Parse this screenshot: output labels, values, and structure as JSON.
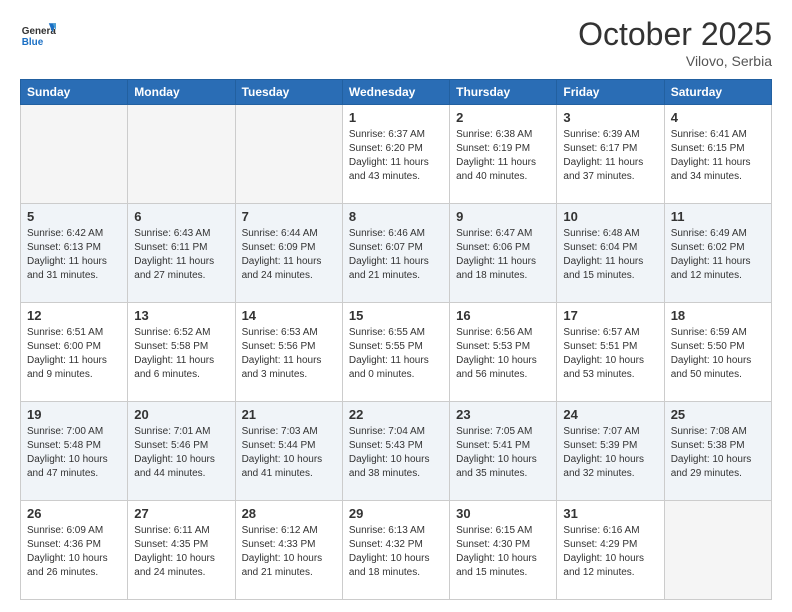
{
  "header": {
    "logo_general": "General",
    "logo_blue": "Blue",
    "month": "October 2025",
    "location": "Vilovo, Serbia"
  },
  "weekdays": [
    "Sunday",
    "Monday",
    "Tuesday",
    "Wednesday",
    "Thursday",
    "Friday",
    "Saturday"
  ],
  "weeks": [
    [
      {
        "day": "",
        "empty": true
      },
      {
        "day": "",
        "empty": true
      },
      {
        "day": "",
        "empty": true
      },
      {
        "day": "1",
        "sunrise": "6:37 AM",
        "sunset": "6:20 PM",
        "daylight": "11 hours and 43 minutes."
      },
      {
        "day": "2",
        "sunrise": "6:38 AM",
        "sunset": "6:19 PM",
        "daylight": "11 hours and 40 minutes."
      },
      {
        "day": "3",
        "sunrise": "6:39 AM",
        "sunset": "6:17 PM",
        "daylight": "11 hours and 37 minutes."
      },
      {
        "day": "4",
        "sunrise": "6:41 AM",
        "sunset": "6:15 PM",
        "daylight": "11 hours and 34 minutes."
      }
    ],
    [
      {
        "day": "5",
        "sunrise": "6:42 AM",
        "sunset": "6:13 PM",
        "daylight": "11 hours and 31 minutes."
      },
      {
        "day": "6",
        "sunrise": "6:43 AM",
        "sunset": "6:11 PM",
        "daylight": "11 hours and 27 minutes."
      },
      {
        "day": "7",
        "sunrise": "6:44 AM",
        "sunset": "6:09 PM",
        "daylight": "11 hours and 24 minutes."
      },
      {
        "day": "8",
        "sunrise": "6:46 AM",
        "sunset": "6:07 PM",
        "daylight": "11 hours and 21 minutes."
      },
      {
        "day": "9",
        "sunrise": "6:47 AM",
        "sunset": "6:06 PM",
        "daylight": "11 hours and 18 minutes."
      },
      {
        "day": "10",
        "sunrise": "6:48 AM",
        "sunset": "6:04 PM",
        "daylight": "11 hours and 15 minutes."
      },
      {
        "day": "11",
        "sunrise": "6:49 AM",
        "sunset": "6:02 PM",
        "daylight": "11 hours and 12 minutes."
      }
    ],
    [
      {
        "day": "12",
        "sunrise": "6:51 AM",
        "sunset": "6:00 PM",
        "daylight": "11 hours and 9 minutes."
      },
      {
        "day": "13",
        "sunrise": "6:52 AM",
        "sunset": "5:58 PM",
        "daylight": "11 hours and 6 minutes."
      },
      {
        "day": "14",
        "sunrise": "6:53 AM",
        "sunset": "5:56 PM",
        "daylight": "11 hours and 3 minutes."
      },
      {
        "day": "15",
        "sunrise": "6:55 AM",
        "sunset": "5:55 PM",
        "daylight": "11 hours and 0 minutes."
      },
      {
        "day": "16",
        "sunrise": "6:56 AM",
        "sunset": "5:53 PM",
        "daylight": "10 hours and 56 minutes."
      },
      {
        "day": "17",
        "sunrise": "6:57 AM",
        "sunset": "5:51 PM",
        "daylight": "10 hours and 53 minutes."
      },
      {
        "day": "18",
        "sunrise": "6:59 AM",
        "sunset": "5:50 PM",
        "daylight": "10 hours and 50 minutes."
      }
    ],
    [
      {
        "day": "19",
        "sunrise": "7:00 AM",
        "sunset": "5:48 PM",
        "daylight": "10 hours and 47 minutes."
      },
      {
        "day": "20",
        "sunrise": "7:01 AM",
        "sunset": "5:46 PM",
        "daylight": "10 hours and 44 minutes."
      },
      {
        "day": "21",
        "sunrise": "7:03 AM",
        "sunset": "5:44 PM",
        "daylight": "10 hours and 41 minutes."
      },
      {
        "day": "22",
        "sunrise": "7:04 AM",
        "sunset": "5:43 PM",
        "daylight": "10 hours and 38 minutes."
      },
      {
        "day": "23",
        "sunrise": "7:05 AM",
        "sunset": "5:41 PM",
        "daylight": "10 hours and 35 minutes."
      },
      {
        "day": "24",
        "sunrise": "7:07 AM",
        "sunset": "5:39 PM",
        "daylight": "10 hours and 32 minutes."
      },
      {
        "day": "25",
        "sunrise": "7:08 AM",
        "sunset": "5:38 PM",
        "daylight": "10 hours and 29 minutes."
      }
    ],
    [
      {
        "day": "26",
        "sunrise": "6:09 AM",
        "sunset": "4:36 PM",
        "daylight": "10 hours and 26 minutes."
      },
      {
        "day": "27",
        "sunrise": "6:11 AM",
        "sunset": "4:35 PM",
        "daylight": "10 hours and 24 minutes."
      },
      {
        "day": "28",
        "sunrise": "6:12 AM",
        "sunset": "4:33 PM",
        "daylight": "10 hours and 21 minutes."
      },
      {
        "day": "29",
        "sunrise": "6:13 AM",
        "sunset": "4:32 PM",
        "daylight": "10 hours and 18 minutes."
      },
      {
        "day": "30",
        "sunrise": "6:15 AM",
        "sunset": "4:30 PM",
        "daylight": "10 hours and 15 minutes."
      },
      {
        "day": "31",
        "sunrise": "6:16 AM",
        "sunset": "4:29 PM",
        "daylight": "10 hours and 12 minutes."
      },
      {
        "day": "",
        "empty": true
      }
    ]
  ]
}
